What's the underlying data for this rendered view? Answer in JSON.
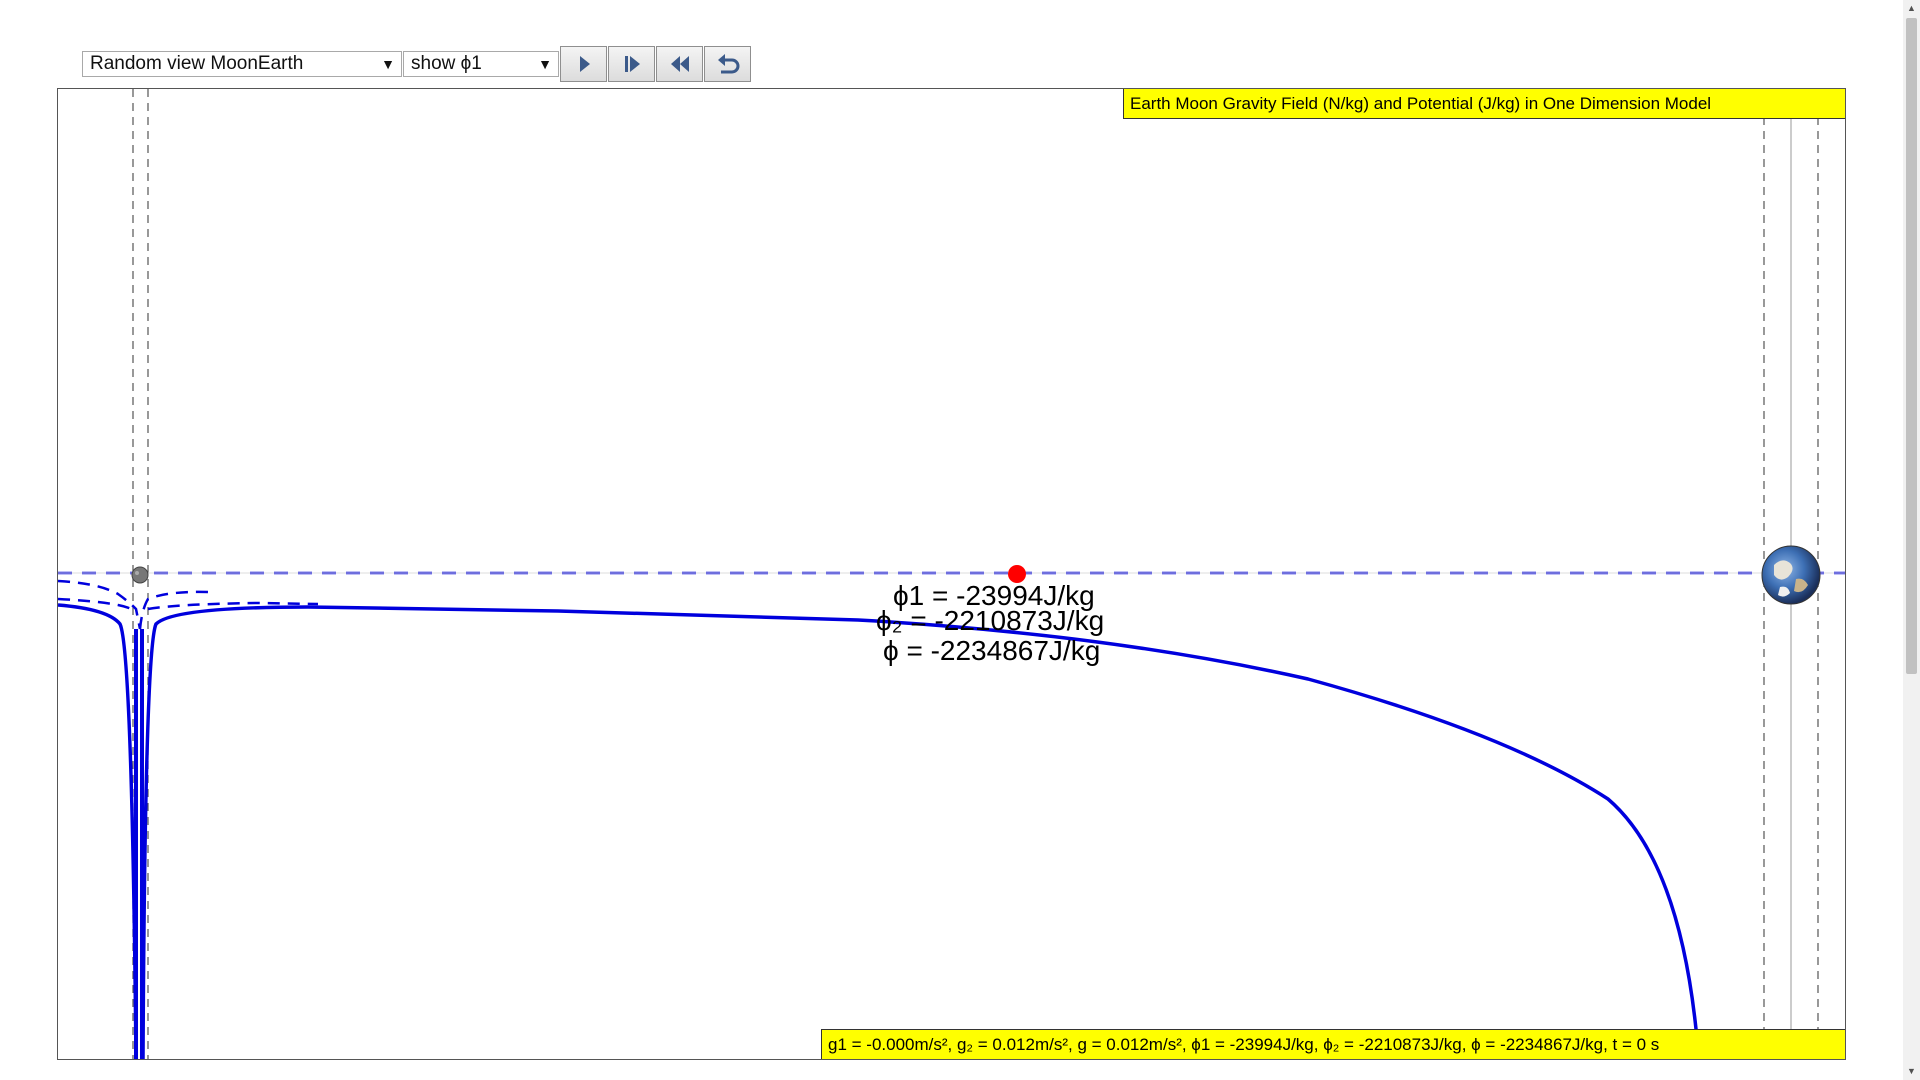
{
  "toolbar": {
    "view_select": {
      "selected": "Random view MoonEarth"
    },
    "show_select": {
      "selected": "show ϕ1"
    },
    "buttons": [
      {
        "name": "play-icon"
      },
      {
        "name": "step-forward-icon"
      },
      {
        "name": "rewind-icon"
      },
      {
        "name": "reset-icon"
      }
    ]
  },
  "plot": {
    "title": "Earth Moon Gravity Field (N/kg) and Potential (J/kg) in One Dimension Model",
    "status": "g1 = -0.000m/s², g₂ = 0.012m/s², g = 0.012m/s², ϕ1 = -23994J/kg, ϕ₂ = -2210873J/kg, ϕ = -2234867J/kg, t = 0 s",
    "readouts": {
      "phi1": "ϕ1 = -23994J/kg",
      "phi2": "ϕ₂ = -2210873J/kg",
      "phi": "ϕ = -2234867J/kg"
    },
    "colors": {
      "curve": "#0000dd",
      "probe": "#ff0000",
      "label_bg": "#ffff00"
    }
  }
}
